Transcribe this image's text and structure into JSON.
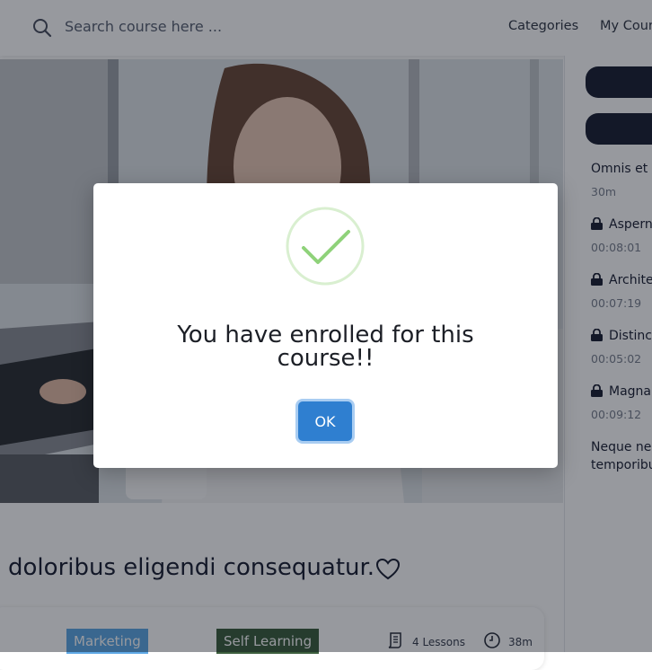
{
  "header": {
    "search_placeholder": "Search course here ...",
    "nav": [
      "Categories",
      "My Cours"
    ]
  },
  "sidebar": {
    "section_title": "Omnis et r",
    "section_duration": "30m",
    "lessons": [
      {
        "title": "Asperna",
        "duration": "00:08:01"
      },
      {
        "title": "Architec",
        "duration": "00:07:19"
      },
      {
        "title": "Distinct",
        "duration": "00:05:02"
      },
      {
        "title": "Magnar",
        "duration": "00:09:12"
      }
    ],
    "next_section_line1": "Neque nec",
    "next_section_line2": "temporibu"
  },
  "course": {
    "title": ": doloribus eligendi consequatur.",
    "tags": [
      "Marketing",
      "Self Learning"
    ],
    "lessons": "4 Lessons",
    "duration": "38m"
  },
  "modal": {
    "message": "You have enrolled for this course!!",
    "ok_label": "OK"
  },
  "colors": {
    "accent": "#2f7fd0",
    "success": "#8fd27a",
    "dark": "#1d2235",
    "tag_blue": "#5fa9e6",
    "tag_green": "#3d5f3e"
  }
}
